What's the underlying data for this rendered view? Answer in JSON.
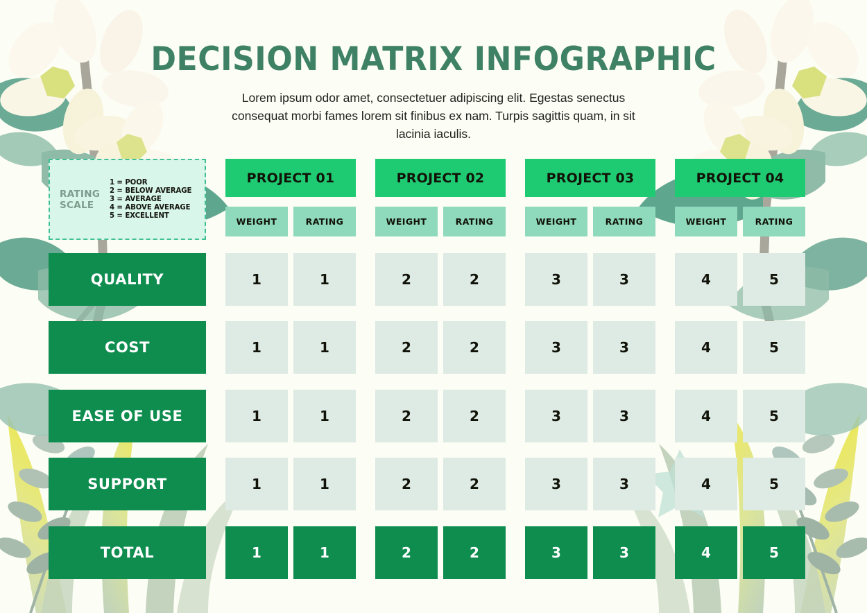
{
  "header": {
    "title": "DECISION MATRIX INFOGRAPHIC",
    "subtitle": "Lorem ipsum odor amet, consectetuer adipiscing elit. Egestas senectus consequat morbi fames lorem sit finibus ex nam. Turpis sagittis quam, in sit lacinia iaculis."
  },
  "rating_scale": {
    "label": "RATING SCALE",
    "items": [
      "1 = POOR",
      "2 = BELOW AVERAGE",
      "3 = AVERAGE",
      "4 = ABOVE AVERAGE",
      "5 = EXCELLENT"
    ]
  },
  "matrix": {
    "projects": [
      "PROJECT 01",
      "PROJECT 02",
      "PROJECT 03",
      "PROJECT 04"
    ],
    "subcolumns": [
      "WEIGHT",
      "RATING"
    ],
    "criteria": [
      "QUALITY",
      "COST",
      "EASE OF USE",
      "SUPPORT"
    ],
    "total_label": "TOTAL",
    "rows": [
      {
        "criterion": "QUALITY",
        "values": [
          "1",
          "1",
          "2",
          "2",
          "3",
          "3",
          "4",
          "5"
        ]
      },
      {
        "criterion": "COST",
        "values": [
          "1",
          "1",
          "2",
          "2",
          "3",
          "3",
          "4",
          "5"
        ]
      },
      {
        "criterion": "EASE OF USE",
        "values": [
          "1",
          "1",
          "2",
          "2",
          "3",
          "3",
          "4",
          "5"
        ]
      },
      {
        "criterion": "SUPPORT",
        "values": [
          "1",
          "1",
          "2",
          "2",
          "3",
          "3",
          "4",
          "5"
        ]
      }
    ],
    "total_row": {
      "criterion": "TOTAL",
      "values": [
        "1",
        "1",
        "2",
        "2",
        "3",
        "3",
        "4",
        "5"
      ]
    }
  },
  "colors": {
    "background": "#FCFDF4",
    "title": "#3E8165",
    "project_header": "#1FCB72",
    "subheader": "#8FD9BC",
    "row_label": "#0E8D4F",
    "data_cell": "#DEEAE4",
    "total_cell": "#0E8D4F",
    "rating_box_fill": "#D8F7EA",
    "rating_box_border": "#3FBF93"
  }
}
